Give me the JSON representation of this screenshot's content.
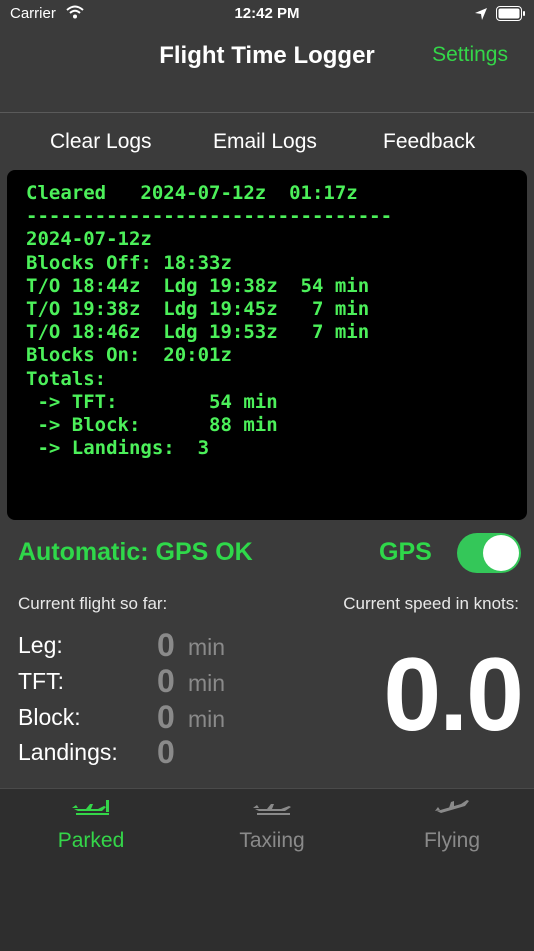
{
  "status_bar": {
    "carrier": "Carrier",
    "time": "12:42 PM"
  },
  "nav": {
    "title": "Flight Time Logger",
    "settings_label": "Settings"
  },
  "actions": {
    "clear": "Clear Logs",
    "email": "Email Logs",
    "feedback": "Feedback"
  },
  "log": {
    "lines": [
      "Cleared   2024-07-12z  01:17z",
      "--------------------------------",
      "2024-07-12z",
      "Blocks Off: 18:33z",
      "T/O 18:44z  Ldg 19:38z  54 min",
      "T/O 19:38z  Ldg 19:45z   7 min",
      "T/O 18:46z  Ldg 19:53z   7 min",
      "Blocks On:  20:01z",
      "Totals:",
      " -> TFT:        54 min",
      " -> Block:      88 min",
      " -> Landings:  3"
    ]
  },
  "gps": {
    "status": "Automatic: GPS OK",
    "label": "GPS",
    "enabled": true
  },
  "flight": {
    "label": "Current flight so far:",
    "stats": [
      {
        "label": "Leg:",
        "value": "0",
        "unit": "min"
      },
      {
        "label": "TFT:",
        "value": "0",
        "unit": "min"
      },
      {
        "label": "Block:",
        "value": "0",
        "unit": "min"
      },
      {
        "label": "Landings:",
        "value": "0",
        "unit": ""
      }
    ]
  },
  "speed": {
    "label": "Current speed in knots:",
    "value": "0.0"
  },
  "tabs": [
    {
      "label": "Parked",
      "icon": "plane-parked-icon",
      "active": true
    },
    {
      "label": "Taxiing",
      "icon": "plane-taxiing-icon",
      "active": false
    },
    {
      "label": "Flying",
      "icon": "plane-flying-icon",
      "active": false
    }
  ],
  "colors": {
    "accent": "#34d649",
    "log_text": "#4cf05a",
    "inactive": "#8a8a8a",
    "toggle_on": "#34c759"
  }
}
